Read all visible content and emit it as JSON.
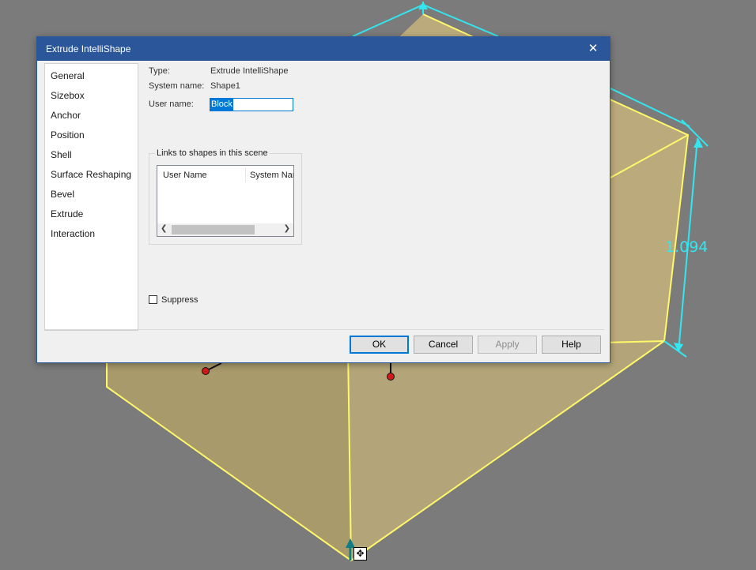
{
  "viewport": {
    "background_color": "#7b7b7b",
    "shape_face_color": "#c7b47c",
    "shape_edge_color": "#fff86a",
    "dimension_color": "#33e6f0",
    "dimension_value": "1.094"
  },
  "dialog": {
    "title": "Extrude IntelliShape",
    "close_glyph": "✕",
    "titlebar_color": "#2b579a",
    "nav_items": [
      "General",
      "Sizebox",
      "Anchor",
      "Position",
      "Shell",
      "Surface Reshaping",
      "Bevel",
      "Extrude",
      "Interaction"
    ],
    "general": {
      "type_label": "Type:",
      "type_value": "Extrude IntelliShape",
      "system_name_label": "System name:",
      "system_name_value": "Shape1",
      "user_name_label": "User name:",
      "user_name_value": "Block",
      "links_group_label": "Links to shapes in this scene",
      "links_columns": [
        "User Name",
        "System Nar"
      ],
      "suppress_label": "Suppress",
      "suppress_checked": false
    },
    "buttons": {
      "ok": "OK",
      "cancel": "Cancel",
      "apply": "Apply",
      "help": "Help"
    }
  },
  "cursor": {
    "icon": "move-cursor-icon",
    "glyph": "✥"
  }
}
